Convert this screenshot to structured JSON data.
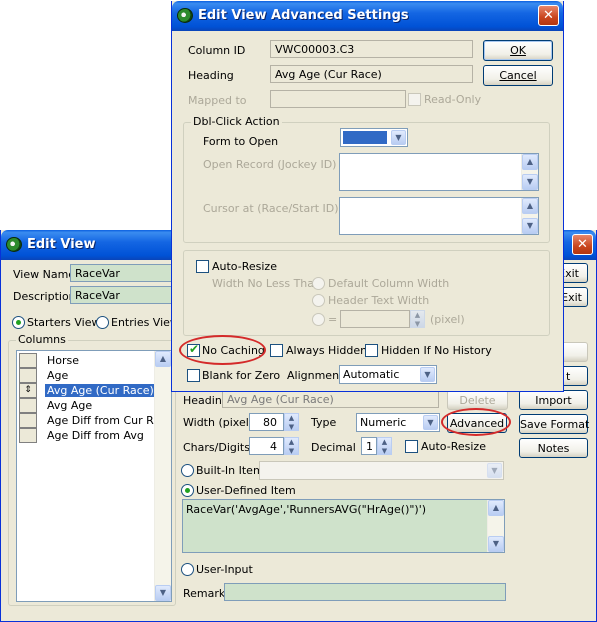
{
  "edit_view": {
    "title": "Edit View",
    "view_name_label": "View Name",
    "view_name_value": "RaceVar",
    "description_label": "Description",
    "description_value": "RaceVar",
    "view_mode_options": [
      "Starters View",
      "Entries View"
    ],
    "view_mode_selected": "Starters View",
    "columns_label": "Columns",
    "columns": [
      "Horse",
      "Age",
      "Avg Age (Cur Race)",
      "Avg Age",
      "Age Diff from Cur Ra",
      "Age Diff from Avg"
    ],
    "selected_column": "Avg Age (Cur Race)",
    "heading_label": "Heading",
    "heading_value": "Avg Age (Cur Race)",
    "delete_label": "Delete",
    "width_label": "Width (pixel)",
    "width_value": "80",
    "type_label": "Type",
    "type_value": "Numeric",
    "advanced_label": "Advanced",
    "chars_label": "Chars/Digits",
    "chars_value": "4",
    "decimal_label": "Decimal",
    "decimal_value": "1",
    "auto_resize_label": "Auto-Resize",
    "builtin_label": "Built-In Item",
    "user_defined_label": "User-Defined Item",
    "item_source_selected": "User-Defined Item",
    "formula": "RaceVar('AvgAge','RunnersAVG(\"HrAge()\")')",
    "user_input_label": "User-Input",
    "remark_label": "Remark",
    "right_buttons": [
      "Exit",
      "Exit",
      "Import",
      "Save Format",
      "Notes"
    ],
    "hidden_button_partial": "t"
  },
  "advanced": {
    "title": "Edit View Advanced Settings",
    "column_id_label": "Column ID",
    "column_id_value": "VWC00003.C3",
    "heading_label": "Heading",
    "heading_value": "Avg Age (Cur Race)",
    "mapped_to_label": "Mapped to",
    "read_only_label": "Read-Only",
    "ok_label": "OK",
    "cancel_label": "Cancel",
    "dblclick_group_label": "Dbl-Click Action",
    "form_to_open_label": "Form to Open",
    "open_record_label": "Open Record (Jockey ID)",
    "cursor_at_label": "Cursor at (Race/Start ID)",
    "auto_resize_label": "Auto-Resize",
    "width_no_less_label": "Width No Less Than",
    "default_col_width_label": "Default Column Width",
    "header_text_width_label": "Header Text Width",
    "eq_label": "=",
    "pixel_label": "(pixel)",
    "no_caching_label": "No Caching",
    "no_caching_checked": true,
    "always_hidden_label": "Always Hidden",
    "hidden_no_history_label": "Hidden If No History",
    "blank_for_zero_label": "Blank for Zero",
    "alignment_label": "Alignment",
    "alignment_value": "Automatic"
  },
  "colors": {
    "window_bg": "#ece9d8",
    "title_bar": "#0052d6",
    "field_green": "#cfe2cb",
    "selection": "#316ac5",
    "highlight_ellipse": "#d42a2a",
    "combo_fill": "#316ac5"
  }
}
